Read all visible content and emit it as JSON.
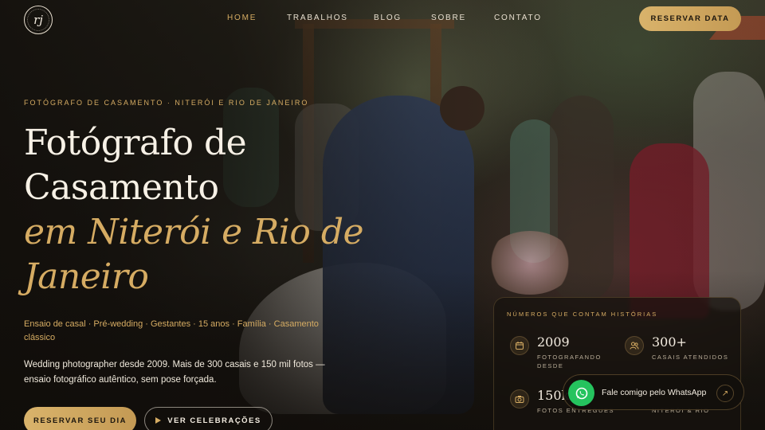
{
  "brand": {
    "logo_monogram": "rj"
  },
  "nav": {
    "items": [
      {
        "label": "HOME"
      },
      {
        "label": "TRABALHOS"
      },
      {
        "label": "BLOG"
      },
      {
        "label": "SOBRE"
      },
      {
        "label": "CONTATO"
      }
    ],
    "active": "HOME",
    "cta_label": "RESERVAR DATA"
  },
  "hero": {
    "eyebrow": "FOTÓGRAFO DE CASAMENTO · NITERÓI E RIO DE JANEIRO",
    "title_line1": "Fotógrafo de",
    "title_line2": "Casamento",
    "title_gold_line1": "em Niterói e Rio de",
    "title_gold_line2": "Janeiro",
    "services": "Ensaio de casal · Pré-wedding · Gestantes · 15 anos · Família · Casamento clássico",
    "lead": "Wedding photographer desde 2009. Mais de 300 casais e 150 mil fotos — ensaio fotográfico autêntico, sem pose forçada.",
    "primary_button": "RESERVAR SEU DIA",
    "secondary_button": "VER CELEBRAÇÕES"
  },
  "stats": {
    "title": "NÚMEROS QUE CONTAM HISTÓRIAS",
    "items": [
      {
        "icon": "calendar-icon",
        "value": "2009",
        "label": "FOTOGRAFANDO DESDE"
      },
      {
        "icon": "users-icon",
        "value": "300+",
        "label": "CASAIS ATENDIDOS"
      },
      {
        "icon": "camera-icon",
        "value": "150k",
        "label": "FOTOS ENTREGUES"
      },
      {
        "icon": "map-pin-icon",
        "value": "",
        "label": "NITERÓI & RIO"
      }
    ]
  },
  "whatsapp": {
    "label": "Fale comigo pelo WhatsApp",
    "icon": "whatsapp-icon",
    "arrow_icon": "arrow-up-right-icon"
  },
  "colors": {
    "gold": "#d6ac63",
    "whatsapp_green": "#25c35e",
    "background": "#14110d"
  }
}
